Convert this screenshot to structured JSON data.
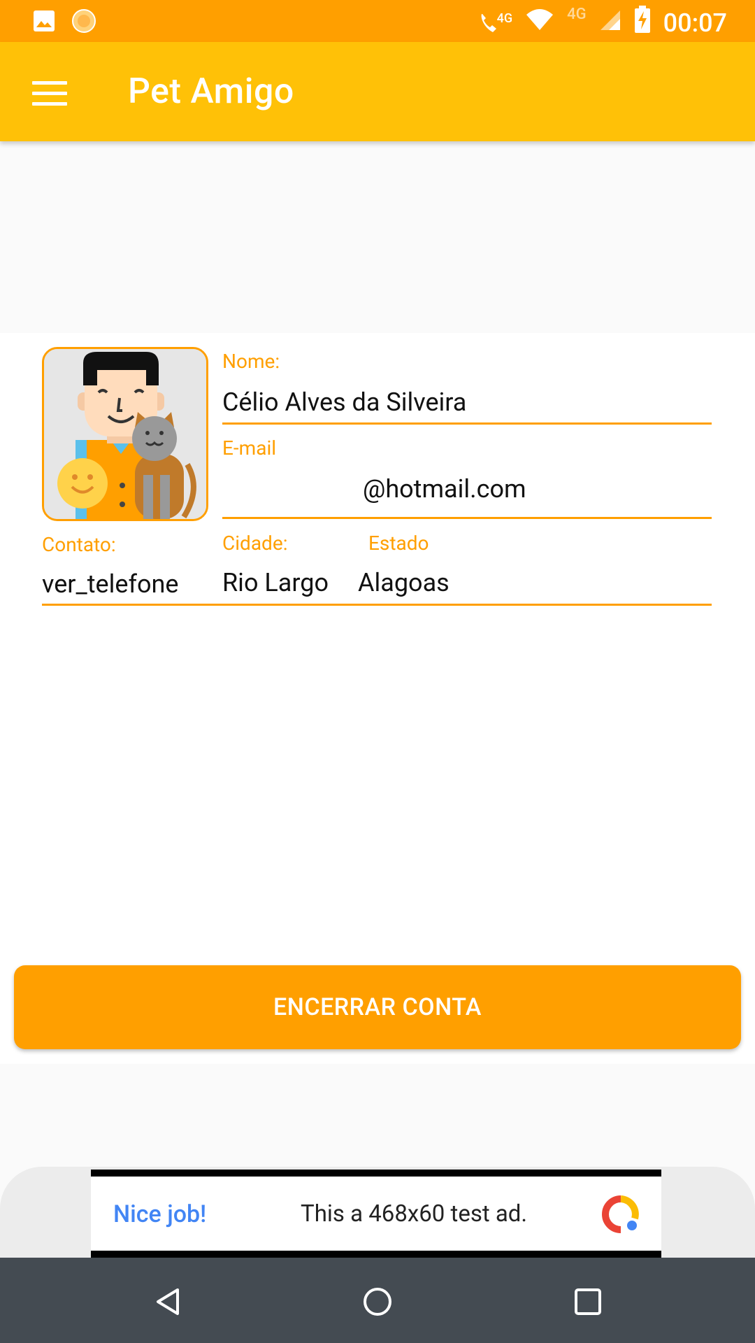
{
  "status_bar": {
    "time": "00:07",
    "network_1": "4G",
    "network_2": "4G",
    "icons": [
      "image-icon",
      "sun-icon",
      "wifi-call-icon",
      "wifi-icon",
      "signal-icon",
      "battery-charging-icon"
    ]
  },
  "app_bar": {
    "title": "Pet Amigo",
    "menu_icon": "menu-icon"
  },
  "profile": {
    "name_label": "Nome:",
    "name_value": "Célio Alves da Silveira",
    "email_label": "E-mail",
    "email_value": "@hotmail.com",
    "contact_label": "Contato:",
    "contact_value": "ver_telefone",
    "city_label": "Cidade:",
    "city_value": "Rio Largo",
    "state_label": "Estado",
    "state_value": "Alagoas",
    "avatar_icon": "person-with-cat-avatar"
  },
  "actions": {
    "close_account_label": "ENCERRAR CONTA"
  },
  "ad": {
    "nice_job": "Nice job!",
    "text": "This a 468x60 test ad."
  },
  "colors": {
    "accent": "#ff9f00",
    "appbar": "#ffc107",
    "statusbar": "#ff9f00",
    "navbar": "#444b52"
  }
}
